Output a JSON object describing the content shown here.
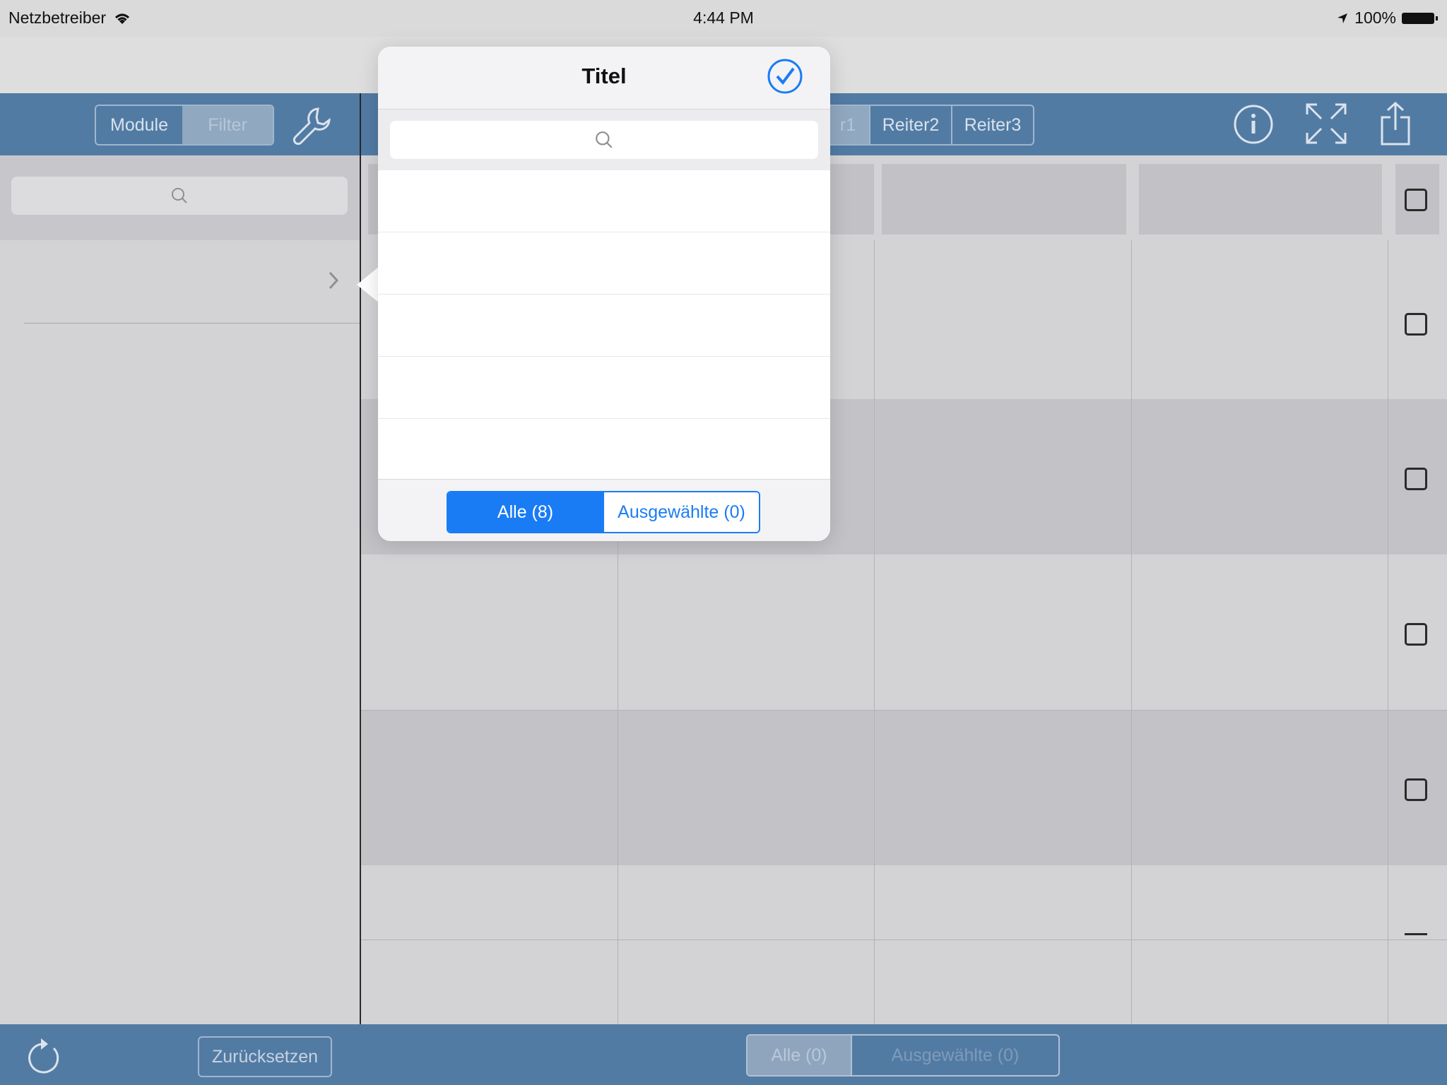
{
  "status_bar": {
    "carrier": "Netzbetreiber",
    "time": "4:44 PM",
    "battery": "100%"
  },
  "toolbar": {
    "left_segment": [
      "Module",
      "Filter"
    ],
    "tabs": [
      "r1",
      "Reiter2",
      "Reiter3"
    ]
  },
  "popover": {
    "title": "Titel",
    "segment": [
      "Alle (8)",
      "Ausgewählte (0)"
    ]
  },
  "bottom_bar": {
    "reset_label": "Zurücksetzen",
    "segment": [
      "Alle (0)",
      "Ausgewählte (0)"
    ]
  },
  "colors": {
    "bar_blue": "#527ba4",
    "accent_blue": "#1a7cf5"
  },
  "icons": {
    "toolbar": [
      "wrench-icon",
      "info-icon",
      "fullscreen-icon",
      "share-icon"
    ],
    "bottom": [
      "refresh-icon"
    ],
    "popover": [
      "checkmark-circle-icon",
      "search-icon"
    ]
  }
}
